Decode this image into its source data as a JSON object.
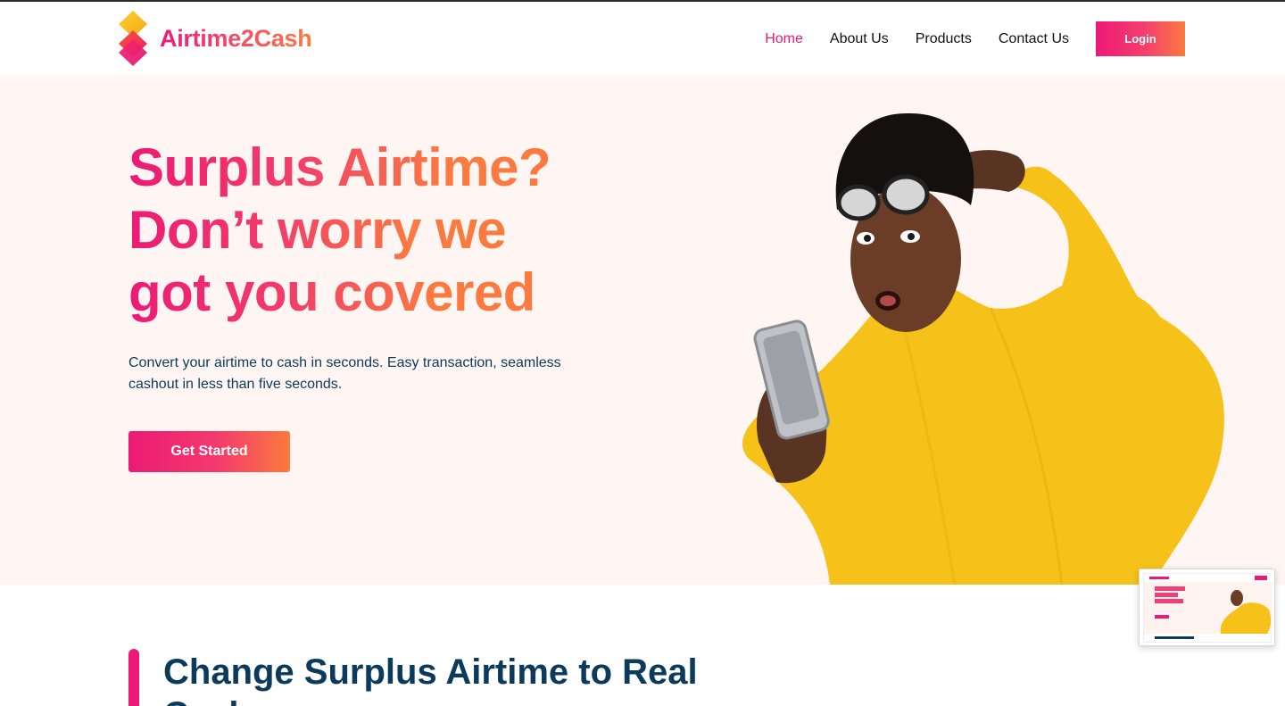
{
  "brand": {
    "name": "Airtime2Cash"
  },
  "nav": {
    "items": [
      {
        "label": "Home",
        "active": true
      },
      {
        "label": "About Us",
        "active": false
      },
      {
        "label": "Products",
        "active": false
      },
      {
        "label": "Contact Us",
        "active": false
      }
    ],
    "login_label": "Login"
  },
  "hero": {
    "title_lines": [
      "Surplus Airtime?",
      "Don’t worry we",
      "got you covered"
    ],
    "subtitle": "Convert your airtime to cash in seconds. Easy transaction, seamless cashout in less than five seconds.",
    "cta_label": "Get Started"
  },
  "section": {
    "title": "Change Surplus Airtime to Real Cash"
  },
  "colors": {
    "accent_pink": "#ee1976",
    "accent_orange": "#fb7a3e",
    "navy": "#0b3a5c",
    "hero_bg": "#fff6f3",
    "sweater_yellow": "#f6c21a"
  },
  "icons": {
    "logo": "stacked-diamond-logo-icon"
  }
}
